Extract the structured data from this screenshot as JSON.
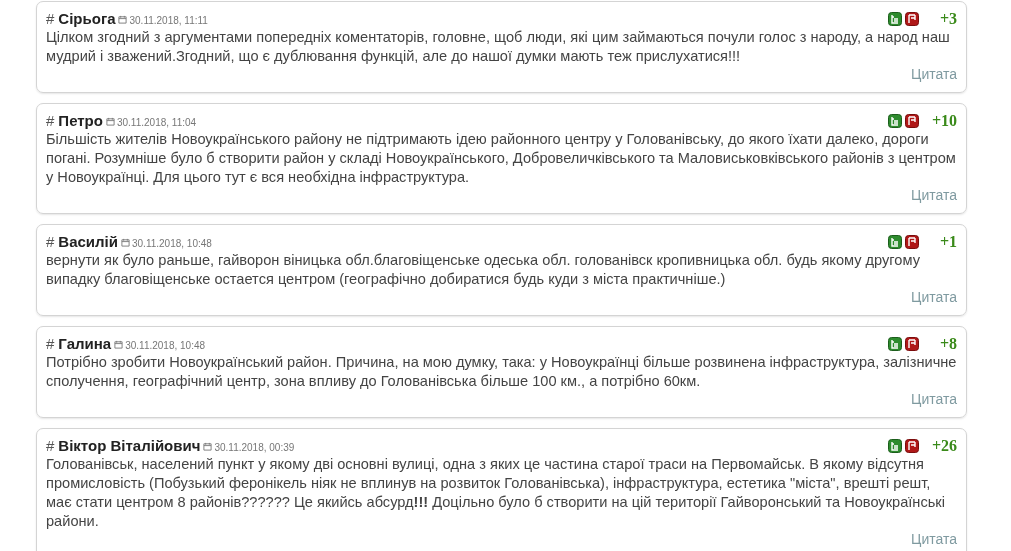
{
  "comments": [
    {
      "hash": "#",
      "author": "Сірьога",
      "date": "30.11.2018, 11:11",
      "score": "+3",
      "text": "Цілком згодний з аргументами попередніх коментаторів, головне, щоб люди, які цим займаються почули голос з народу, а народ наш мудрий і зважений.Згодний, що є дублювання функцій, але до нашої думки мають теж прислухатися!!!",
      "quote": "Цитата"
    },
    {
      "hash": "#",
      "author": "Петро",
      "date": "30.11.2018, 11:04",
      "score": "+10",
      "text": "Більшість жителів Новоукраїнського району не підтримають ідею районного центру у Голованівську, до якого їхати далеко, дороги погані. Розумніше було б створити район у складі Новоукраїнського, Добровеличківського та Маловиськовківського районів з центром у Новоукраїнці. Для цього тут є вся необхідна інфраструктура.",
      "quote": "Цитата"
    },
    {
      "hash": "#",
      "author": "Василій",
      "date": "30.11.2018, 10:48",
      "score": "+1",
      "text": "вернути як було раньше, гайворон віницька обл.благовіщенське одеська обл. голованівск кропивницька обл. будь якому другому випадку благовіщенське остается центром (географічно добиратися будь куди з міста практичніше.)",
      "quote": "Цитата"
    },
    {
      "hash": "#",
      "author": "Галина",
      "date": "30.11.2018, 10:48",
      "score": "+8",
      "text": "Потрібно зробити Новоукраїнський район. Причина, на мою думку, така: у Новоукраїнці більше розвинена інфраструктура, залізничне сполучення, географічний центр, зона впливу до Голованівська більше 100 км., а потрібно 60км.",
      "quote": "Цитата"
    },
    {
      "hash": "#",
      "author": "Віктор Віталійович",
      "date": "30.11.2018, 00:39",
      "score": "+26",
      "text": "Голованівськ, населений пункт у якому дві основні вулиці, одна з яких це частина старої траси на Первомайськ. В якому відсутня промисловість (Побузький феронікель ніяк не вплинув на розвиток Голованівська), інфраструктура, естетика \"міста\", врешті решт, має стати центром 8 районів?????? Це якийсь абсурд**!!!** Доцільно було б створити на цій території Гайворонський та Новоукраїнські райони.",
      "quote": "Цитата"
    }
  ]
}
